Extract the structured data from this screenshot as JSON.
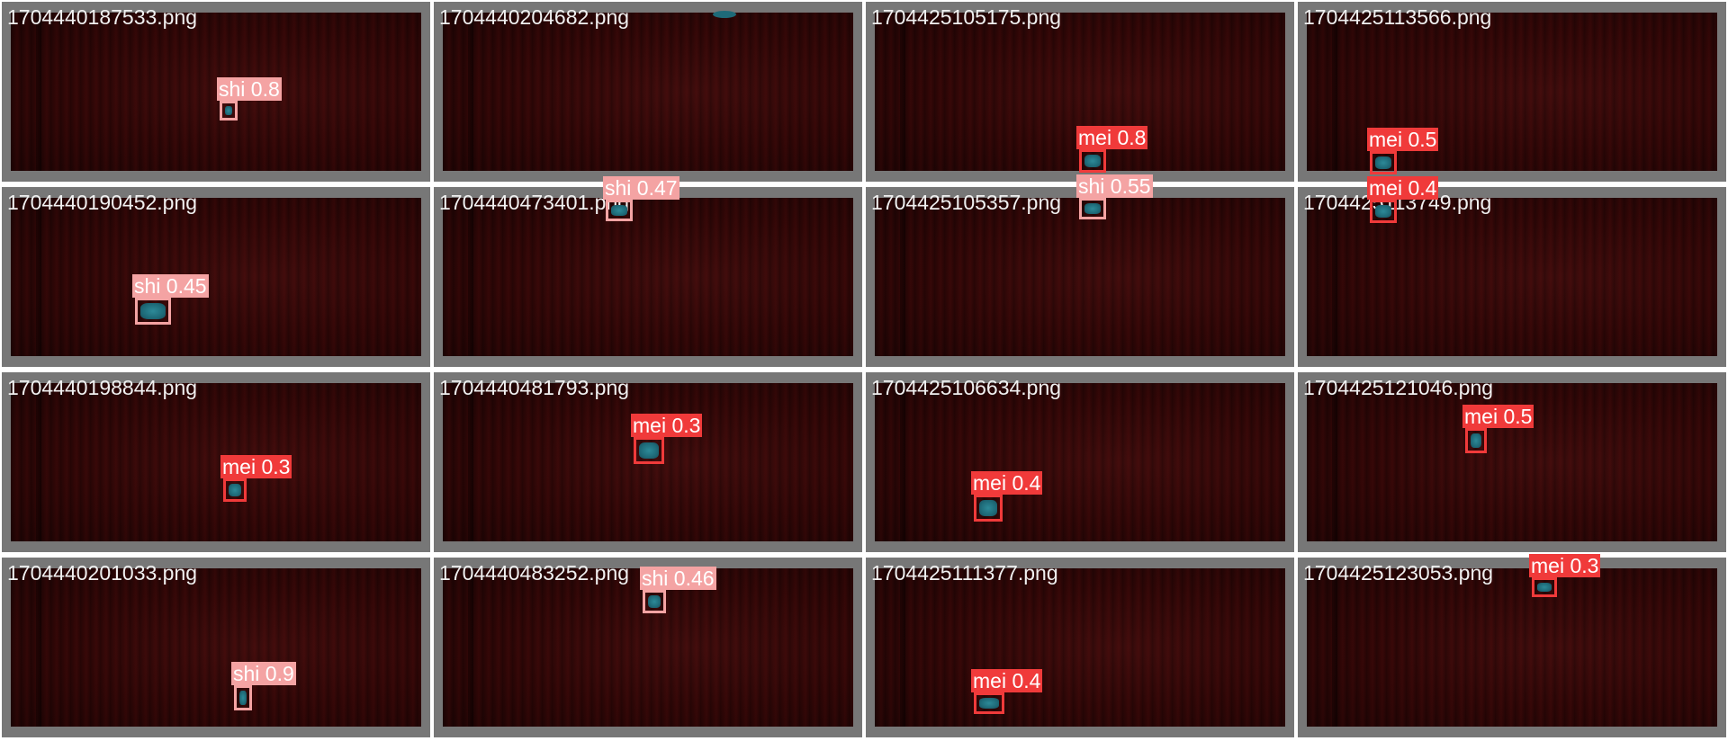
{
  "colors": {
    "shi": "#f4a3a3",
    "mei": "#f03a3a",
    "frame": "#777777"
  },
  "tiles": [
    {
      "file": "1704440187533.png",
      "detections": [
        {
          "label": "shi 0.8",
          "cls": "shi"
        }
      ]
    },
    {
      "file": "1704440204682.png",
      "detections": []
    },
    {
      "file": "1704425105175.png",
      "detections": [
        {
          "label": "mei 0.8",
          "cls": "mei"
        }
      ]
    },
    {
      "file": "1704425113566.png",
      "detections": [
        {
          "label": "mei 0.5",
          "cls": "mei"
        }
      ]
    },
    {
      "file": "1704440190452.png",
      "detections": [
        {
          "label": "shi 0.45",
          "cls": "shi"
        }
      ]
    },
    {
      "file": "1704440473401.png",
      "detections": [
        {
          "label": "shi 0.47",
          "cls": "shi"
        }
      ]
    },
    {
      "file": "1704425105357.png",
      "detections": [
        {
          "label": "shi 0.55",
          "cls": "shi"
        }
      ]
    },
    {
      "file": "1704425113749.png",
      "detections": [
        {
          "label": "mei 0.4",
          "cls": "mei"
        }
      ]
    },
    {
      "file": "1704440198844.png",
      "detections": [
        {
          "label": "mei 0.3",
          "cls": "mei"
        }
      ]
    },
    {
      "file": "1704440481793.png",
      "detections": [
        {
          "label": "mei 0.3",
          "cls": "mei"
        }
      ]
    },
    {
      "file": "1704425106634.png",
      "detections": [
        {
          "label": "mei 0.4",
          "cls": "mei"
        }
      ]
    },
    {
      "file": "1704425121046.png",
      "detections": [
        {
          "label": "mei 0.5",
          "cls": "mei"
        }
      ]
    },
    {
      "file": "1704440201033.png",
      "detections": [
        {
          "label": "shi 0.9",
          "cls": "shi"
        }
      ]
    },
    {
      "file": "1704440483252.png",
      "detections": [
        {
          "label": "shi 0.46",
          "cls": "shi"
        }
      ]
    },
    {
      "file": "1704425111377.png",
      "detections": [
        {
          "label": "mei 0.4",
          "cls": "mei"
        }
      ]
    },
    {
      "file": "1704425123053.png",
      "detections": [
        {
          "label": "mei 0.3",
          "cls": "mei"
        }
      ]
    }
  ]
}
